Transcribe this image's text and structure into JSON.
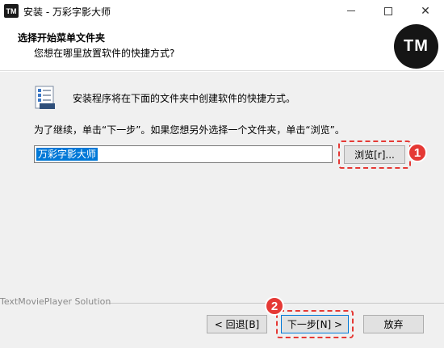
{
  "window": {
    "app_icon_text": "TM",
    "title": "安装 - 万彩字影大师",
    "minimize_icon": "minimize-icon",
    "maximize_icon": "maximize-icon",
    "close_icon": "close-icon"
  },
  "header": {
    "title": "选择开始菜单文件夹",
    "subtitle": "您想在哪里放置软件的快捷方式?",
    "logo_text": "TM"
  },
  "main": {
    "intro": "安装程序将在下面的文件夹中创建软件的快捷方式。",
    "continue_text": "为了继续，单击“下一步”。如果您想另外选择一个文件夹，单击“浏览”。",
    "folder_value": "万彩字影大师",
    "browse_label": "浏览[r]...",
    "brand": "TextMoviePlayer Solution"
  },
  "footer": {
    "back_label": "< 回退[B]",
    "next_label": "下一步[N] >",
    "cancel_label": "放弃"
  },
  "annotations": {
    "badge_1": "1",
    "badge_2": "2",
    "highlight_color": "#e53935"
  }
}
